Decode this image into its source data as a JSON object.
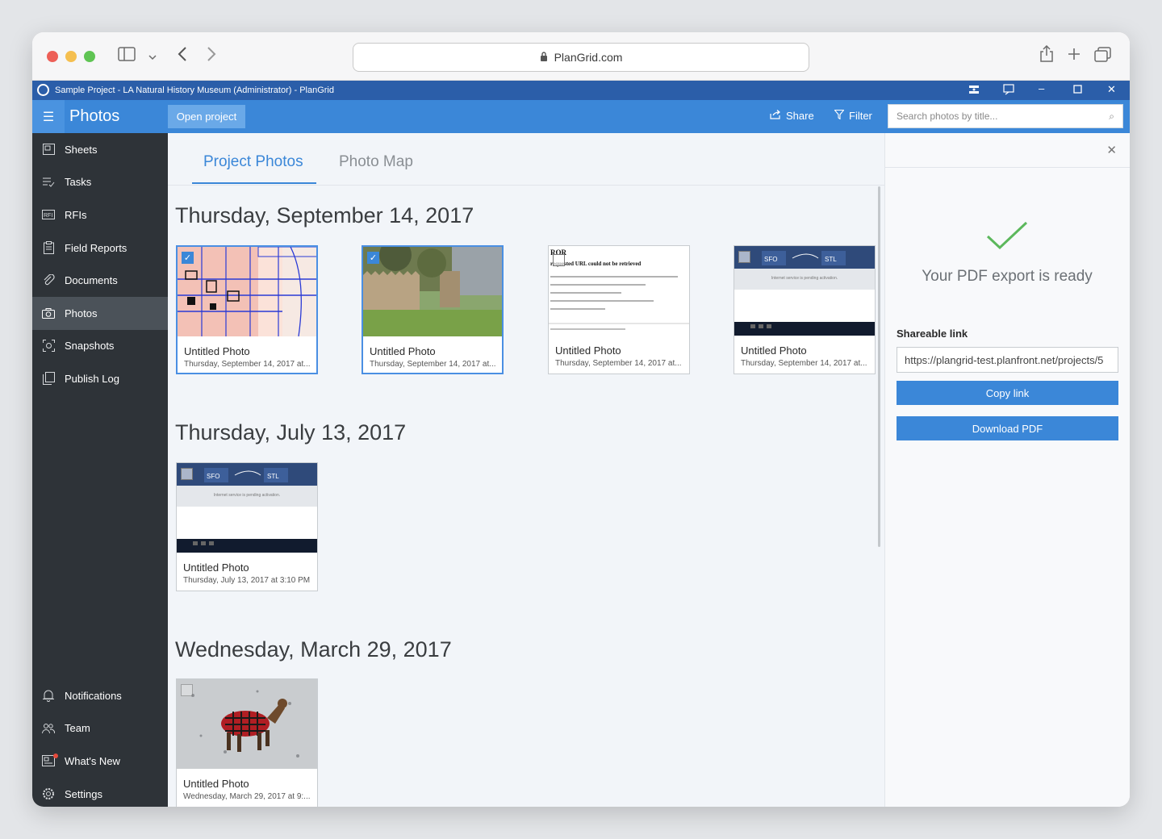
{
  "browser": {
    "url": "PlanGrid.com"
  },
  "titlebar": {
    "text": "Sample Project - LA Natural History Museum (Administrator) - PlanGrid"
  },
  "header": {
    "title": "Photos",
    "open_project": "Open project",
    "share": "Share",
    "filter": "Filter",
    "search_placeholder": "Search photos by title..."
  },
  "sidebar": {
    "items": [
      {
        "label": "Sheets",
        "icon": "sheets-icon"
      },
      {
        "label": "Tasks",
        "icon": "tasks-icon"
      },
      {
        "label": "RFIs",
        "icon": "rfi-icon"
      },
      {
        "label": "Field Reports",
        "icon": "clipboard-icon"
      },
      {
        "label": "Documents",
        "icon": "paperclip-icon"
      },
      {
        "label": "Photos",
        "icon": "camera-icon"
      },
      {
        "label": "Snapshots",
        "icon": "snapshot-icon"
      },
      {
        "label": "Publish Log",
        "icon": "publish-log-icon"
      }
    ],
    "bottom": [
      {
        "label": "Notifications",
        "icon": "bell-icon"
      },
      {
        "label": "Team",
        "icon": "team-icon"
      },
      {
        "label": "What's New",
        "icon": "news-icon"
      },
      {
        "label": "Settings",
        "icon": "gear-icon"
      }
    ]
  },
  "tabs": [
    "Project Photos",
    "Photo Map"
  ],
  "groups": [
    {
      "date": "Thursday, September 14, 2017",
      "photos": [
        {
          "title": "Untitled Photo",
          "subtitle": "Thursday, September 14, 2017 at..."
        },
        {
          "title": "Untitled Photo",
          "subtitle": "Thursday, September 14, 2017 at..."
        },
        {
          "title": "Untitled Photo",
          "subtitle": "Thursday, September 14, 2017 at..."
        },
        {
          "title": "Untitled Photo",
          "subtitle": "Thursday, September 14, 2017 at..."
        }
      ]
    },
    {
      "date": "Thursday, July 13, 2017",
      "photos": [
        {
          "title": "Untitled Photo",
          "subtitle": "Thursday, July 13, 2017 at 3:10 PM"
        }
      ]
    },
    {
      "date": "Wednesday, March 29, 2017",
      "photos": [
        {
          "title": "Untitled Photo",
          "subtitle": "Wednesday, March 29, 2017 at 9:..."
        }
      ]
    }
  ],
  "thumbs": {
    "error_title": "ROR",
    "error_heading": "requested URL could not be retrieved",
    "flight_from": "SFO",
    "flight_to": "STL",
    "flight_notice": "Internet service is pending activation."
  },
  "panel": {
    "ready_text": "Your PDF export is ready",
    "share_label": "Shareable link",
    "link": "https://plangrid-test.planfront.net/projects/5",
    "copy_link": "Copy link",
    "download_pdf": "Download PDF"
  },
  "colors": {
    "accent": "#3b87d8",
    "titlebar": "#2b5ea9",
    "sidebar": "#2e3338",
    "success": "#5cb85c"
  }
}
